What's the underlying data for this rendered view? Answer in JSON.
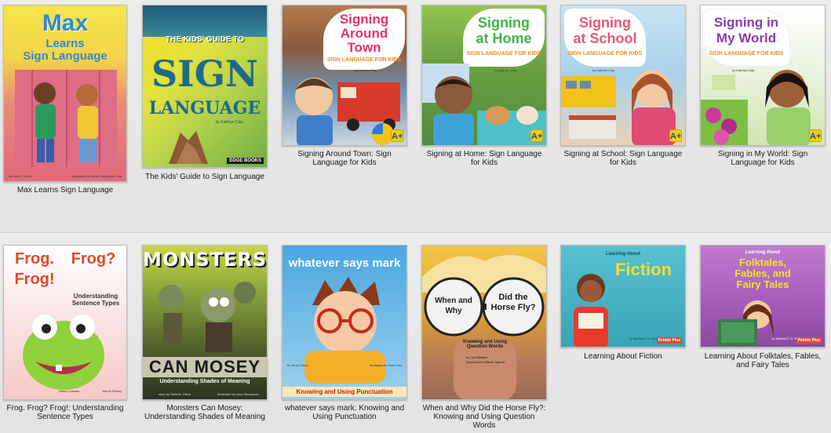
{
  "books": [
    {
      "title": "Max Learns Sign Language",
      "cover": {
        "title_lines": [
          "Max",
          "Learns",
          "Sign Language"
        ],
        "author": "by Adria F. Klein",
        "illustrator": "Illustrated by Mernie Gallagher-Cole"
      }
    },
    {
      "title": "The Kids' Guide to Sign Language",
      "cover": {
        "title_lines": [
          "THE KIDS' GUIDE TO",
          "SIGN",
          "LANGUAGE"
        ],
        "author": "by Kathryn Clay",
        "publisher": "EDGE BOOKS"
      }
    },
    {
      "title": "Signing Around Town: Sign Language for Kids",
      "cover": {
        "title_lines": [
          "Signing",
          "Around",
          "Town"
        ],
        "series": "SIGN LANGUAGE FOR KIDS",
        "author": "by Kathryn Clay",
        "illustrator": "Illustrated by Mick Reed",
        "badge": "A+"
      }
    },
    {
      "title": "Signing at Home: Sign Language for Kids",
      "cover": {
        "title_lines": [
          "Signing",
          "at Home"
        ],
        "series": "SIGN LANGUAGE FOR KIDS",
        "author": "by Kathryn Clay",
        "illustrator": "Illustrated by Randy Chewning",
        "badge": "A+"
      }
    },
    {
      "title": "Signing at School: Sign Language for Kids",
      "cover": {
        "title_lines": [
          "Signing",
          "at School"
        ],
        "series": "SIGN LANGUAGE FOR KIDS",
        "author": "by Kathryn Clay",
        "illustrator": "Illustrated by Margeaux Lucas",
        "badge": "A+"
      }
    },
    {
      "title": "Signing in My World: Sign Language for Kids",
      "cover": {
        "title_lines": [
          "Signing in",
          "My World"
        ],
        "series": "SIGN LANGUAGE FOR KIDS",
        "author": "by Kathryn Clay",
        "illustrator": "Illustrated by Daniel Griffo",
        "badge": "A+"
      }
    },
    {
      "title": "Frog. Frog? Frog!: Understanding Sentence Types",
      "cover": {
        "title_lines": [
          "Frog.",
          "Frog?",
          "Frog!"
        ],
        "series": "Understanding Sentence Types",
        "author": "Nancy Loewen",
        "illustrator": "Merrill Rainey"
      }
    },
    {
      "title": "Monsters Can Mosey: Understanding Shades of Meaning",
      "cover": {
        "title_lines": [
          "MONSTERS",
          "CAN MOSEY"
        ],
        "series": "Understanding Shades of Meaning",
        "author": "story by Gillia M. Olson",
        "illustrator": "illustrated by Ivica Stevanovic"
      }
    },
    {
      "title": "whatever says mark: Knowing and Using Punctuation",
      "cover": {
        "title_lines": [
          "whatever says mark"
        ],
        "series": "Knowing and Using Punctuation",
        "author": "by Terry Collins",
        "illustrator": "illustrated by Sean Cox"
      }
    },
    {
      "title": "When and Why Did the Horse Fly?: Knowing and Using Question Words",
      "cover": {
        "title_lines": [
          "When and Why",
          "Did the Horse Fly?"
        ],
        "series": "Knowing and Using Question Words",
        "author": "by Cari Meister",
        "illustrator": "illustrated by Marek Jagucki"
      }
    },
    {
      "title": "Learning About Fiction",
      "cover": {
        "title_lines": [
          "Learning About",
          "Fiction"
        ],
        "author": "by Martha E. H. Rustad",
        "publisher": "Pebble Plus"
      }
    },
    {
      "title": "Learning About Folktales, Fables, and Fairy Tales",
      "cover": {
        "title_lines": [
          "Learning About",
          "Folktales,",
          "Fables, and",
          "Fairy Tales"
        ],
        "author": "by Martha E. H. Rustad",
        "publisher": "Pebble Plus"
      }
    }
  ],
  "colors": {
    "background": "#e6e6e6",
    "caption_text": "#1a1a1a"
  }
}
